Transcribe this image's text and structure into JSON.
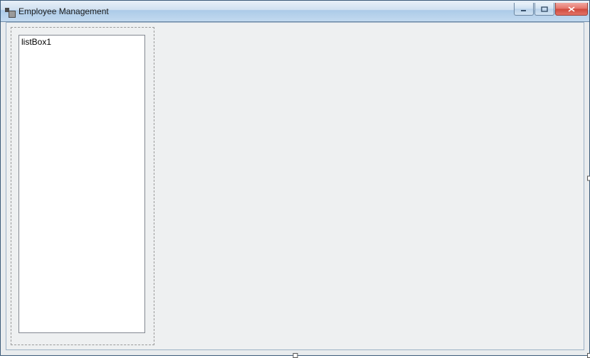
{
  "window": {
    "title": "Employee Management"
  },
  "panel": {
    "listbox": {
      "items": [
        "listBox1"
      ]
    }
  }
}
